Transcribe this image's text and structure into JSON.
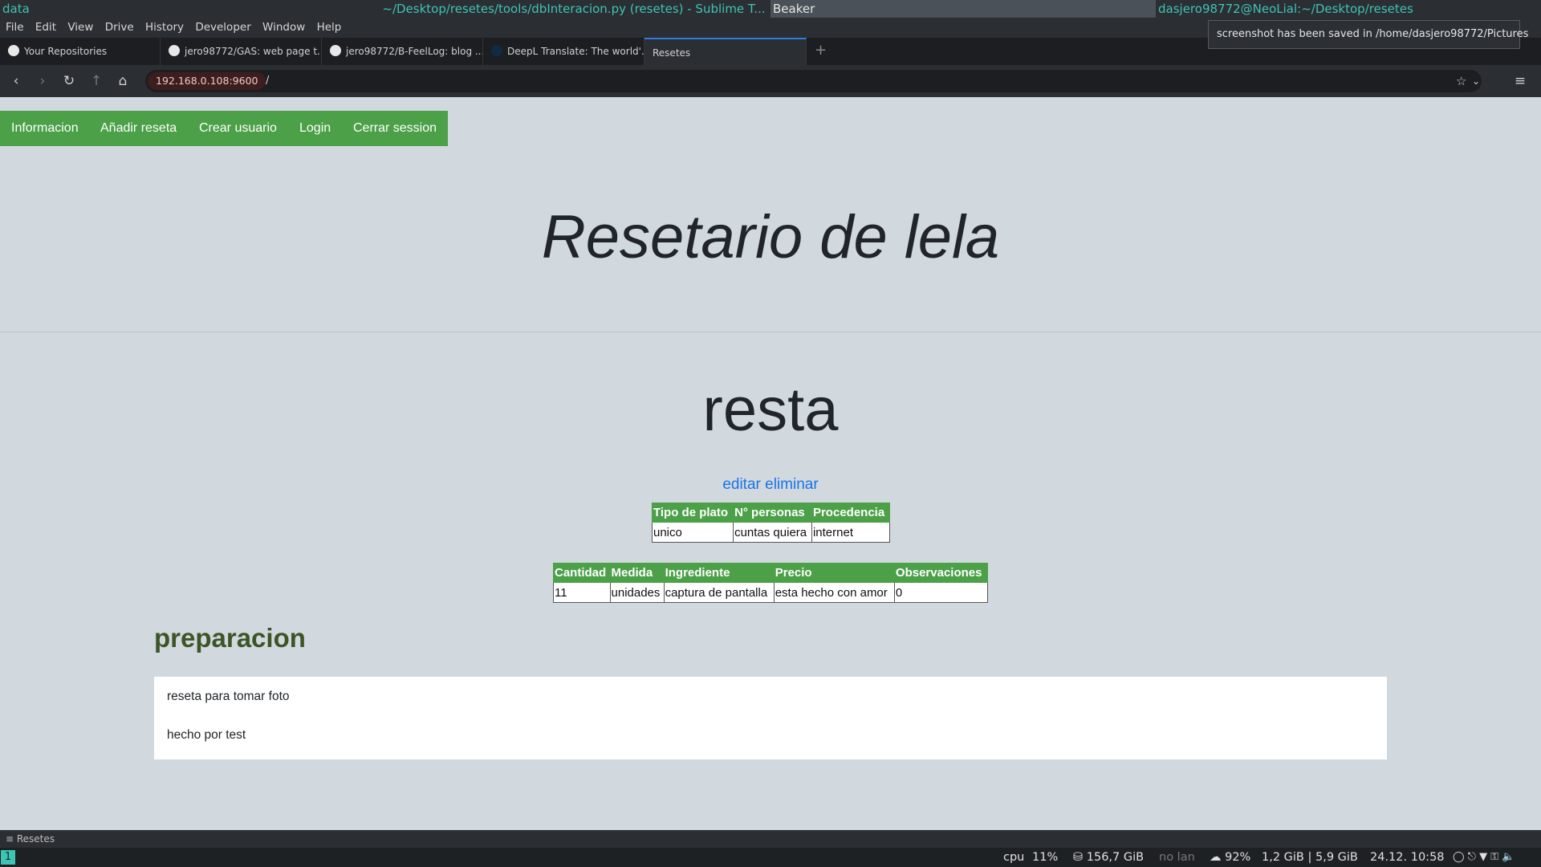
{
  "topbar": {
    "left": "data",
    "center": "~/Desktop/resetes/tools/dbInteracion.py (resetes) - Sublime T...",
    "active": "Beaker",
    "right": "dasjero98772@NeoLial:~/Desktop/resetes"
  },
  "menu": [
    "File",
    "Edit",
    "View",
    "Drive",
    "History",
    "Developer",
    "Window",
    "Help"
  ],
  "tabs": [
    {
      "label": "Your Repositories",
      "icon": "github-icon"
    },
    {
      "label": "jero98772/GAS: web page t...",
      "icon": "github-icon"
    },
    {
      "label": "jero98772/B-FeelLog: blog ...",
      "icon": "github-icon"
    },
    {
      "label": "DeepL Translate: The world'...",
      "icon": "deepl-icon"
    },
    {
      "label": "Resetes",
      "icon": "",
      "active": true
    }
  ],
  "notification": "screenshot has been saved in /home/dasjero98772/Pictures",
  "address": {
    "host": "192.168.0.108:9600",
    "path": "/"
  },
  "site": {
    "nav": [
      "Informacion",
      "Añadir reseta",
      "Crear usuario",
      "Login",
      "Cerrar session"
    ],
    "hero_title": "Resetario de lela",
    "recipe_title": "resta",
    "actions": {
      "edit": "editar",
      "delete": "eliminar"
    },
    "info_table": {
      "headers": [
        "Tipo de plato",
        "N° personas",
        "Procedencia"
      ],
      "row": [
        "unico",
        "cuntas quiera",
        "internet"
      ]
    },
    "ingredients_table": {
      "headers": [
        "Cantidad",
        "Medida",
        "Ingrediente",
        "Precio",
        "Observaciones"
      ],
      "row": [
        "11",
        "unidades",
        "captura de pantalla",
        "esta hecho con amor",
        "0"
      ]
    },
    "preparation_title": "preparacion",
    "preparation_lines": [
      "reseta para tomar foto",
      "hecho por test"
    ]
  },
  "statusline": "≡ Resetes",
  "bottombar": {
    "workspace": "1",
    "cpu_label": "cpu",
    "cpu": "11%",
    "disk": "⛁ 156,7 GiB",
    "lan": "no lan",
    "wifi": "☁ 92%",
    "mem": "1,2 GiB | 5,9 GiB",
    "datetime": "24.12. 10:58",
    "tray": "◯ ⎋ ▼ ⚿ 🔈"
  },
  "colors": {
    "accent_green": "#4ba048",
    "page_bg": "#d1d9df",
    "link_blue": "#1a73e8",
    "i3_teal": "#3ec4b4"
  }
}
